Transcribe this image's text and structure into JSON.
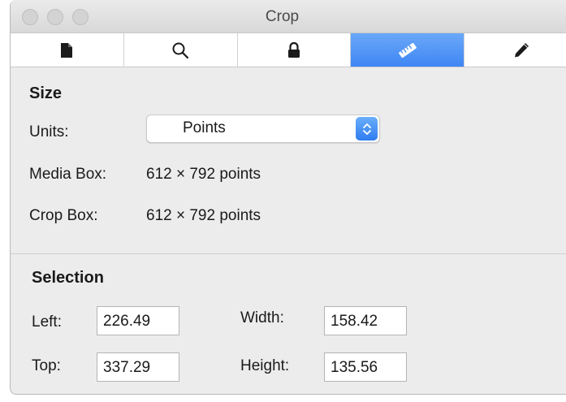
{
  "window": {
    "title": "Crop"
  },
  "toolbar": {
    "tabs": [
      {
        "icon": "document-icon",
        "active": false
      },
      {
        "icon": "magnifier-icon",
        "active": false
      },
      {
        "icon": "lock-icon",
        "active": false
      },
      {
        "icon": "ruler-icon",
        "active": true
      },
      {
        "icon": "pencil-icon",
        "active": false
      }
    ],
    "active_color": "#4a90f5"
  },
  "size": {
    "heading": "Size",
    "units_label": "Units:",
    "units_value": "Points",
    "media_box_label": "Media Box:",
    "media_box_value": "612 × 792 points",
    "crop_box_label": "Crop Box:",
    "crop_box_value": "612 × 792 points"
  },
  "selection": {
    "heading": "Selection",
    "left_label": "Left:",
    "left_value": "226.49",
    "top_label": "Top:",
    "top_value": "337.29",
    "width_label": "Width:",
    "width_value": "158.42",
    "height_label": "Height:",
    "height_value": "135.56"
  }
}
